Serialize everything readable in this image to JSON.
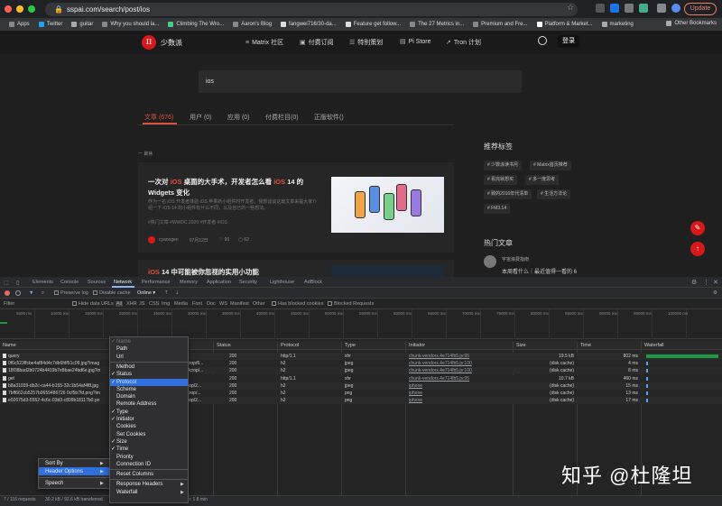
{
  "browser": {
    "url": "sspai.com/search/post/ios",
    "update_label": "Update",
    "bookmarks": [
      "Apps",
      "Twitter",
      "guitar",
      "Why you should la...",
      "Climbing The Wro...",
      "Aaron's Blog",
      "fangwei716/30-da...",
      "Feature get follow...",
      "The 27 Metrics in...",
      "Premium and Fre...",
      "Platform & Market...",
      "marketing"
    ],
    "other_bookmarks": "Other Bookmarks",
    "traffic_colors": [
      "#ff5f57",
      "#febc2e",
      "#28c840"
    ]
  },
  "site": {
    "logo_glyph": "π",
    "logo_text": "少数派",
    "nav": [
      {
        "icon": "≡",
        "label": "Matrix 社区"
      },
      {
        "icon": "▣",
        "label": "付费订阅"
      },
      {
        "icon": "☰",
        "label": "特别策划"
      },
      {
        "icon": "▤",
        "label": "Pi Store"
      },
      {
        "icon": "↗",
        "label": "Tron 计划"
      }
    ],
    "login_label": "登录",
    "accent": "#d7191a"
  },
  "search": {
    "query": "ios",
    "tabs": [
      "文章 (676)",
      "用户 (0)",
      "应用 (0)",
      "付费栏目(0)",
      "正版软件()"
    ],
    "section_label": "一 聚焦"
  },
  "article": {
    "title_a": "一次对 ",
    "title_hl1": "iOS",
    "title_b": " 桌面的大手术，开发者怎么看 ",
    "title_hl2": "iOS",
    "title_c": " 14 的 Widgets 变化",
    "desc": "作为一名 iOS 开发者体验 iOS 苹果新小组件时开发者，我想谈谈这篇文章来提大家介绍一下 iOS 14 的小组件有什么不同，以及自己的一些想法。",
    "tags": "#热门文章  #WWDC 2020  #开发者  #iOS",
    "author": "cyanogen",
    "date": "07月12日",
    "likes": "♡ 90",
    "comments": "▢ 62"
  },
  "article2": {
    "title_hl": "iOS",
    "title_rest": " 14 中可能被你忽视的实用小功能"
  },
  "sidebar": {
    "rec_heading": "推荐标签",
    "rec_tags": [
      "# 少数派读书月",
      "# Matrix首页推荐",
      "# 看完就想买",
      "# 多一度思考",
      "# 致的2010年代清单",
      "# 生活方法论",
      "# FM3.14"
    ],
    "hot_heading": "热门文章",
    "hot_author": "宇宙浪费指南",
    "hot_title": "本周看什么｜最近值得一看的 6"
  },
  "devtools": {
    "tabs": [
      "Elements",
      "Console",
      "Sources",
      "Network",
      "Performance",
      "Memory",
      "Application",
      "Security",
      "Lighthouse",
      "AdBlock"
    ],
    "active_tab": "Network",
    "toolbar": {
      "preserve_log": "Preserve log",
      "disable_cache": "Disable cache",
      "throttle": "Online"
    },
    "filter": {
      "placeholder": "Filter",
      "hide_data_urls": "Hide data URLs",
      "types": [
        "All",
        "XHR",
        "JS",
        "CSS",
        "Img",
        "Media",
        "Font",
        "Doc",
        "WS",
        "Manifest",
        "Other"
      ],
      "blocked_cookies": "Has blocked cookies",
      "blocked_requests": "Blocked Requests"
    },
    "overview_ticks": [
      "5000 ms",
      "10000 ms",
      "15000 ms",
      "20000 ms",
      "25000 ms",
      "30000 ms",
      "35000 ms",
      "40000 ms",
      "45000 ms",
      "50000 ms",
      "55000 ms",
      "60000 ms",
      "65000 ms",
      "70000 ms",
      "75000 ms",
      "80000 ms",
      "85000 ms",
      "90000 ms",
      "95000 ms",
      "100000 ms"
    ],
    "columns": [
      "Name",
      "Status",
      "Protocol",
      "Type",
      "Initiator",
      "Size",
      "Time",
      "Waterfall"
    ],
    "rows": [
      {
        "name": "query",
        "path": "",
        "status": "200",
        "protocol": "http/1.1",
        "type": "xhr",
        "initiator": "chunk-vendors.4e714fb5.js:95",
        "size": "19.5 kB",
        "time": "802 ms"
      },
      {
        "name": "0f6c523ffcbe4af84d4c7db6fdf51c09.jpg?imag",
        "path": "ter/crop/6...",
        "status": "200",
        "protocol": "h2",
        "type": "jpeg",
        "initiator": "chunk-vendors.4e714fb5.js:100",
        "size": "(disk cache)",
        "time": "4 ms"
      },
      {
        "name": "18f38bad2b0724b4419b7e8bae24bd6e.jpg?in",
        "path": "nter/crop/...",
        "status": "200",
        "protocol": "h2",
        "type": "jpeg",
        "initiator": "chunk-vendors.4e714fb5.js:100",
        "size": "(disk cache)",
        "time": "8 ms"
      },
      {
        "name": "get",
        "path": "",
        "status": "200",
        "protocol": "http/1.1",
        "type": "xhr",
        "initiator": "chunk-vendors.4e714fb5.js:95",
        "size": "10.7 kB",
        "time": "460 ms"
      },
      {
        "name": "b8a31039-db2c-ca44-b155-32c1b54af4f8.jpg",
        "path": "w/crop/2...",
        "status": "200",
        "protocol": "h2",
        "type": "jpeg",
        "initiator": "iphone",
        "size": "(disk cache)",
        "time": "15 ms"
      },
      {
        "name": "7bff662cb5257b0659486726 0cf5b7fd.png?im",
        "path": "ter/crop/...",
        "status": "200",
        "protocol": "h2",
        "type": "png",
        "initiator": "iphone",
        "size": "(disk cache)",
        "time": "13 ms"
      },
      {
        "name": "e02675d3-5552-4c6c-03d3-c899b18117b0.pn",
        "path": "w/crop/2...",
        "status": "200",
        "protocol": "h2",
        "type": "png",
        "initiator": "iphone",
        "size": "(disk cache)",
        "time": "17 ms"
      }
    ],
    "status_bar": {
      "requests": "7 / 116 requests",
      "transferred": "30.2 kB / 92.6 kB transferred",
      "finish": "h: 1.8 min"
    }
  },
  "context_menu": {
    "main": [
      "Sort By",
      "Header Options",
      "Speech"
    ],
    "sub": [
      {
        "label": "Name",
        "checked": true,
        "disabled": true
      },
      {
        "label": "Path",
        "checked": false
      },
      {
        "label": "Url",
        "checked": false
      },
      {
        "sep": true
      },
      {
        "label": "Method",
        "checked": false
      },
      {
        "label": "Status",
        "checked": true
      },
      {
        "label": "Protocol",
        "checked": true,
        "highlight": true
      },
      {
        "label": "Scheme",
        "checked": false
      },
      {
        "label": "Domain",
        "checked": false
      },
      {
        "label": "Remote Address",
        "checked": false
      },
      {
        "label": "Type",
        "checked": true
      },
      {
        "label": "Initiator",
        "checked": true
      },
      {
        "label": "Cookies",
        "checked": false
      },
      {
        "label": "Set Cookies",
        "checked": false
      },
      {
        "label": "Size",
        "checked": true
      },
      {
        "label": "Time",
        "checked": true
      },
      {
        "label": "Priority",
        "checked": false
      },
      {
        "label": "Connection ID",
        "checked": false
      },
      {
        "sep": true
      },
      {
        "label": "Reset Columns",
        "checked": false
      },
      {
        "sep": true
      },
      {
        "label": "Response Headers",
        "checked": false,
        "submenu": true
      },
      {
        "label": "Waterfall",
        "checked": false,
        "submenu": true
      }
    ]
  },
  "watermark": "知乎 @杜隆坦"
}
